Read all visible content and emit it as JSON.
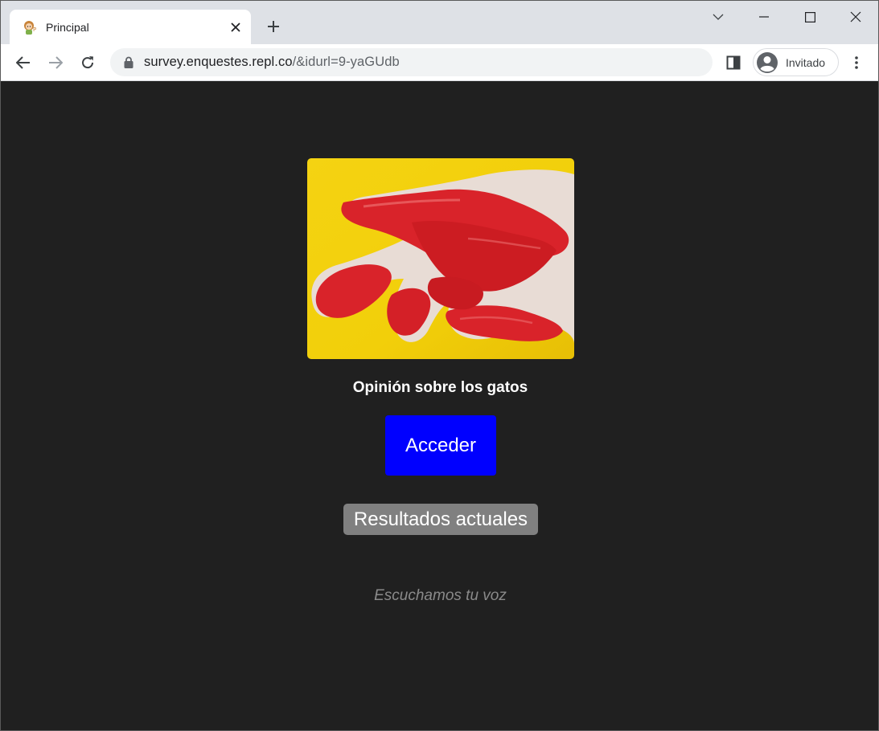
{
  "browser": {
    "tab": {
      "title": "Principal",
      "favicon": "girl-mascot-icon"
    },
    "new_tab_icon": "plus-icon",
    "window_controls": [
      "chevron-down-icon",
      "minimize-icon",
      "maximize-icon",
      "close-icon"
    ],
    "toolbar": {
      "back_icon": "arrow-left-icon",
      "forward_icon": "arrow-right-icon",
      "reload_icon": "reload-icon",
      "url_host": "survey.enquestes.repl.co",
      "url_path": "/&idurl=9-yaGUdb",
      "side_panel_icon": "side-panel-icon",
      "profile_label": "Invitado",
      "menu_icon": "kebab-menu-icon"
    }
  },
  "page": {
    "image": "painted-hand-photo",
    "title": "Opinión sobre los gatos",
    "primary_button": "Acceder",
    "secondary_button": "Resultados actuales",
    "tagline": "Escuchamos tu voz"
  },
  "colors": {
    "page_background": "#202020",
    "primary_button": "#0000ff",
    "secondary_button": "#808080",
    "tagline": "#8a8a8a",
    "photo_background": "#f2cf0a",
    "paint_red": "#d9232a"
  }
}
